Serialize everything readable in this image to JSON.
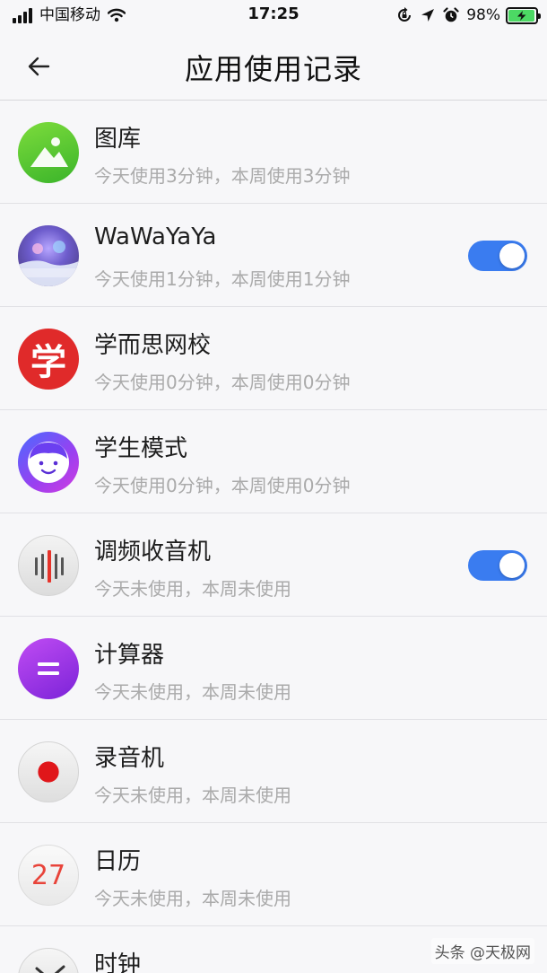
{
  "status_bar": {
    "carrier": "中国移动",
    "time": "17:25",
    "battery_percent": "98%",
    "battery_level": 0.98,
    "icons": [
      "signal-icon",
      "wifi-icon",
      "screen-lock-rotation-icon",
      "location-icon",
      "alarm-icon",
      "battery-charging-icon"
    ]
  },
  "nav": {
    "back_icon": "back-arrow-icon",
    "title": "应用使用记录"
  },
  "apps": [
    {
      "name": "图库",
      "usage": "今天使用3分钟，本周使用3分钟",
      "icon": "gallery-icon",
      "toggle_on": null
    },
    {
      "name": "WaWaYaYa",
      "usage": "今天使用1分钟，本周使用1分钟",
      "icon": "wawayaya-app-icon",
      "toggle_on": true
    },
    {
      "name": "学而思网校",
      "usage": "今天使用0分钟，本周使用0分钟",
      "icon": "xueersi-app-icon",
      "icon_text": "学",
      "toggle_on": null
    },
    {
      "name": "学生模式",
      "usage": "今天使用0分钟，本周使用0分钟",
      "icon": "student-mode-icon",
      "toggle_on": null
    },
    {
      "name": "调频收音机",
      "usage": "今天未使用，本周未使用",
      "icon": "fm-radio-icon",
      "toggle_on": true
    },
    {
      "name": "计算器",
      "usage": "今天未使用，本周未使用",
      "icon": "calculator-icon",
      "toggle_on": null
    },
    {
      "name": "录音机",
      "usage": "今天未使用，本周未使用",
      "icon": "recorder-icon",
      "toggle_on": null
    },
    {
      "name": "日历",
      "usage": "今天未使用，本周未使用",
      "icon": "calendar-icon",
      "icon_text": "27",
      "toggle_on": null
    },
    {
      "name": "时钟",
      "usage": "",
      "icon": "clock-icon",
      "toggle_on": null
    }
  ],
  "colors": {
    "toggle_on": "#3a7cf0",
    "usage_text": "#aaaaaa",
    "divider": "#e1e1e5"
  },
  "watermark": "头条 @天极网"
}
